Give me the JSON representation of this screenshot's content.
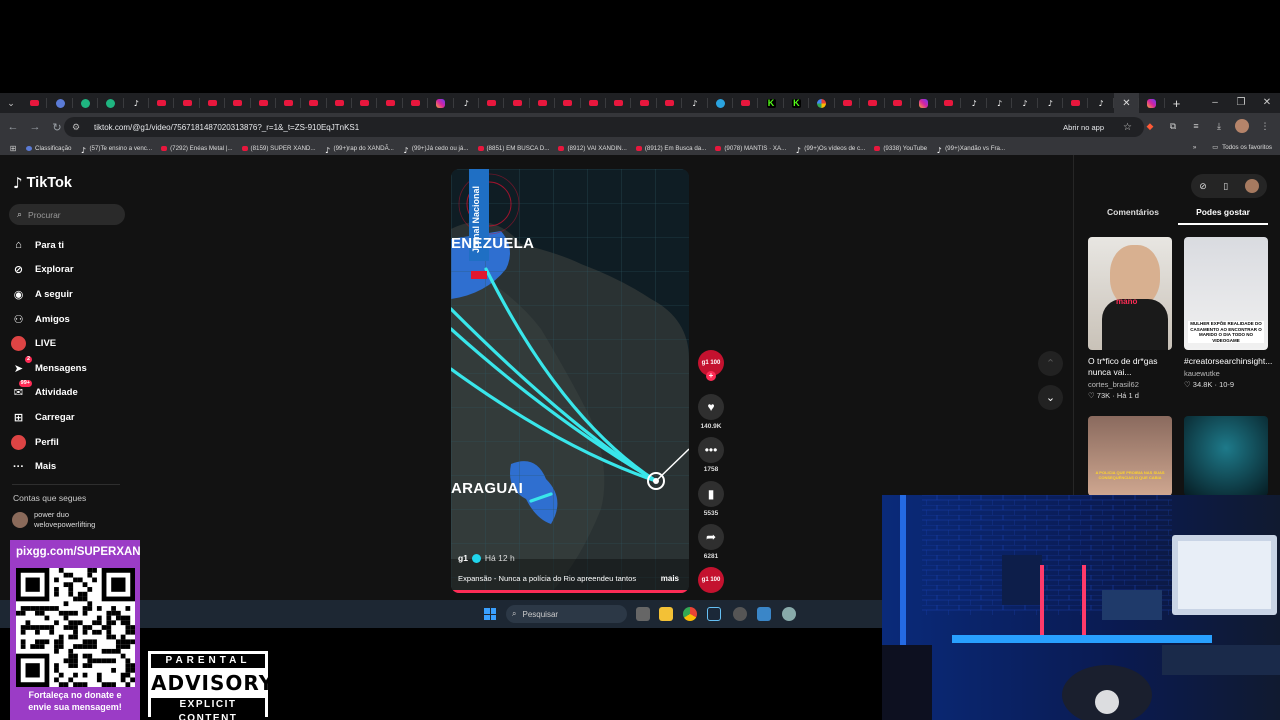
{
  "browser": {
    "tabs": [
      "yt",
      "gen",
      "grn",
      "grn",
      "tt",
      "yt",
      "yt",
      "yt",
      "yt",
      "yt",
      "yt",
      "yt",
      "yt",
      "yt",
      "yt",
      "yt",
      "ig",
      "tt",
      "yt",
      "yt",
      "yt",
      "yt",
      "yt",
      "yt",
      "yt",
      "yt",
      "tt",
      "tg",
      "yt",
      "kick",
      "kick",
      "goog",
      "yt",
      "yt",
      "yt",
      "ig",
      "yt",
      "tt",
      "tt",
      "tt",
      "tt",
      "yt",
      "tt",
      "active",
      "ig"
    ],
    "url": "tiktok.com/@g1/video/7567181487020313876?_r=1&_t=ZS-910EqJTnKS1",
    "open_in_app": "Abrir no app",
    "bookmarks": [
      {
        "icon": "gen",
        "label": "Classificação"
      },
      {
        "icon": "tt",
        "label": "(57)Te ensino a venc..."
      },
      {
        "icon": "yt",
        "label": "(7292) Enéas Metal |..."
      },
      {
        "icon": "yt",
        "label": "(8159) SUPER XAND..."
      },
      {
        "icon": "tt",
        "label": "(99+)rap do XANDÃ..."
      },
      {
        "icon": "tt",
        "label": "(99+)Já cedo ou já..."
      },
      {
        "icon": "yt",
        "label": "(8851) EM BUSCA D..."
      },
      {
        "icon": "yt",
        "label": "(8912) VAI XANDIN..."
      },
      {
        "icon": "yt",
        "label": "(8912) Em Busca da..."
      },
      {
        "icon": "yt",
        "label": "(9078) MANTIS · XA..."
      },
      {
        "icon": "tt",
        "label": "(99+)Os vídeos de c..."
      },
      {
        "icon": "yt",
        "label": "(9338) YouTube"
      },
      {
        "icon": "tt",
        "label": "(99+)Xandão vs Fra..."
      }
    ],
    "all_favorites": "Todos os favoritos"
  },
  "tiktok": {
    "logo": "TikTok",
    "search_placeholder": "Procurar",
    "nav": [
      {
        "icon": "home-icon",
        "label": "Para ti"
      },
      {
        "icon": "compass-icon",
        "label": "Explorar"
      },
      {
        "icon": "following-icon",
        "label": "A seguir"
      },
      {
        "icon": "friends-icon",
        "label": "Amigos"
      },
      {
        "icon": "live-icon",
        "label": "LIVE"
      },
      {
        "icon": "messages-icon",
        "label": "Mensagens",
        "badge": "2"
      },
      {
        "icon": "activity-icon",
        "label": "Atividade",
        "badge": "99+"
      },
      {
        "icon": "upload-icon",
        "label": "Carregar"
      },
      {
        "icon": "profile-icon",
        "label": "Perfil"
      },
      {
        "icon": "more-icon",
        "label": "Mais"
      }
    ],
    "following_title": "Contas que segues",
    "following": [
      {
        "name": "power duo",
        "handle": "welovepowerlifting"
      }
    ],
    "video": {
      "overlay_title": "Jornal Nacional",
      "map_labels": [
        "ENEZUELA",
        "ARAGUAI"
      ],
      "author": "g1",
      "time": "Há 12 h",
      "caption": "Expansão - Nunca a polícia do Rio apreendeu tantos",
      "more": "mais"
    },
    "actions": {
      "channel_logo": "g1 100",
      "likes": "140.9K",
      "comments": "1758",
      "saves": "5535",
      "shares": "6281"
    },
    "right_tabs": [
      "Comentários",
      "Podes gostar"
    ],
    "recommended": [
      {
        "title": "O tr*fico de dr*gas nunca vai...",
        "author": "cortes_brasil62",
        "meta": "♡ 73K · Há 1 d",
        "overlay": "mano"
      },
      {
        "title": "#creatorsearchinsight...",
        "author": "kauewutke",
        "meta": "♡ 34.8K · 10-9",
        "overlay": "MULHER EXPÕE REALIDADE DO CASAMENTO AO ENCONTRAR O MARIDO O DIA TODO NO VIDEOGAME"
      },
      {
        "title": "",
        "author": "",
        "meta": "",
        "overlay": "A POLICIA QUE PROIBIA NAS SUAS CONSEQUÊNCIAS O QUE CABIA"
      },
      {
        "title": "",
        "author": "",
        "meta": "",
        "overlay": ""
      }
    ]
  },
  "taskbar": {
    "search_placeholder": "Pesquisar"
  },
  "stream_overlay": {
    "pix_url": "pixgg.com/SUPERXANDÃO",
    "donate_text_1": "Fortaleça no donate e",
    "donate_text_2": "envie sua mensagem!",
    "advisory_top": "PARENTAL",
    "advisory_mid": "ADVISORY",
    "advisory_bot": "EXPLICIT CONTENT"
  },
  "colors": {
    "tiktok_red": "#fe2c55",
    "map_route": "#39e6ea",
    "g1_red": "#c4122f",
    "pix_purple": "#9b3cc6"
  }
}
